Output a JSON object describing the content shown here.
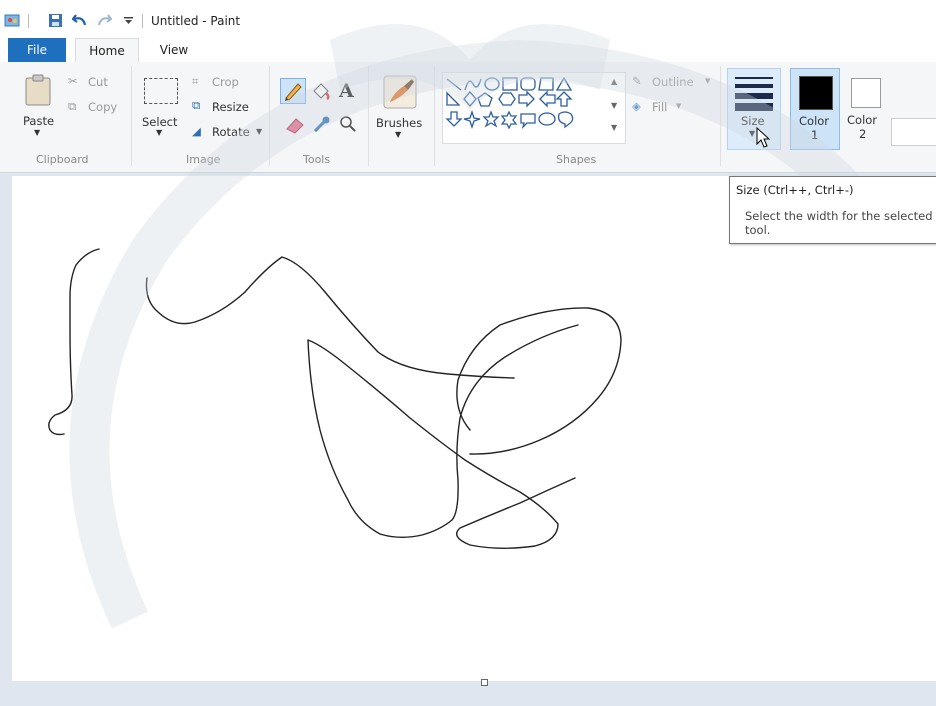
{
  "window": {
    "title": "Untitled - Paint"
  },
  "tabs": [
    {
      "label": "File"
    },
    {
      "label": "Home"
    },
    {
      "label": "View"
    }
  ],
  "ribbon": {
    "clipboard": {
      "group_label": "Clipboard",
      "paste": "Paste",
      "cut": "Cut",
      "copy": "Copy"
    },
    "image": {
      "group_label": "Image",
      "select": "Select",
      "crop": "Crop",
      "resize": "Resize",
      "rotate": "Rotate"
    },
    "tools": {
      "group_label": "Tools"
    },
    "brushes": {
      "label": "Brushes"
    },
    "shapes": {
      "group_label": "Shapes",
      "outline": "Outline",
      "fill": "Fill"
    },
    "size": {
      "label": "Size"
    },
    "colors": {
      "color1": "Color",
      "color1_num": "1",
      "color2": "Color",
      "color2_num": "2"
    }
  },
  "tooltip": {
    "title": "Size (Ctrl++, Ctrl+-)",
    "desc": "Select the width for the selected\ntool."
  },
  "colors": {
    "file_tab": "#1f6fbf",
    "accent_selected": "#cde3f8",
    "color1": "#000000",
    "color2": "#ffffff"
  }
}
